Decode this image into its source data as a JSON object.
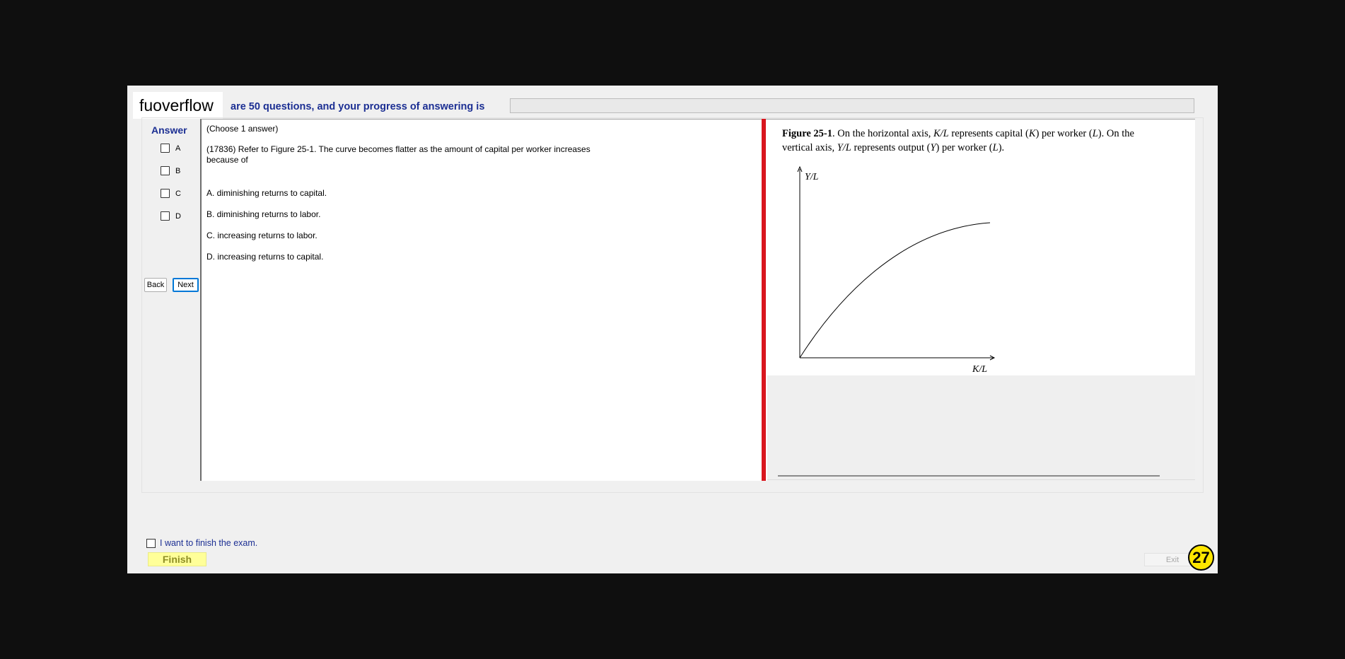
{
  "header": {
    "watermark": "fuoverflow",
    "progress_text": "are 50 questions, and your progress of answering is",
    "progress_fraction": 0
  },
  "answer_panel": {
    "title": "Answer",
    "options": [
      "A",
      "B",
      "C",
      "D"
    ],
    "back_label": "Back",
    "next_label": "Next"
  },
  "question": {
    "instruction": "(Choose 1 answer)",
    "stem_line1": "(17836)  Refer to Figure 25-1.  The curve becomes flatter as the amount of capital per worker increases",
    "stem_line2": "because of",
    "choices": [
      "A.  diminishing returns to capital.",
      "B.  diminishing returns to labor.",
      "C.  increasing returns to labor.",
      "D.  increasing returns to capital."
    ]
  },
  "figure": {
    "title": "Figure 25-1",
    "caption_line1_a": ". On the horizontal axis, ",
    "kl": "K/L",
    "caption_line1_b": " represents capital (",
    "k": "K",
    "caption_line1_c": ") per worker (",
    "l": "L",
    "caption_line1_d": ").  On the",
    "caption_line2_a": "vertical axis, ",
    "yl": "Y/L",
    "caption_line2_b": " represents output (",
    "y": "Y",
    "caption_line2_c": ") per worker (",
    "caption_line2_d": ").",
    "y_axis_label": "Y/L",
    "x_axis_label": "K/L"
  },
  "footer": {
    "finish_check_label": "I want to finish the exam.",
    "finish_label": "Finish",
    "exit_label": "Exit",
    "question_number": "27"
  }
}
